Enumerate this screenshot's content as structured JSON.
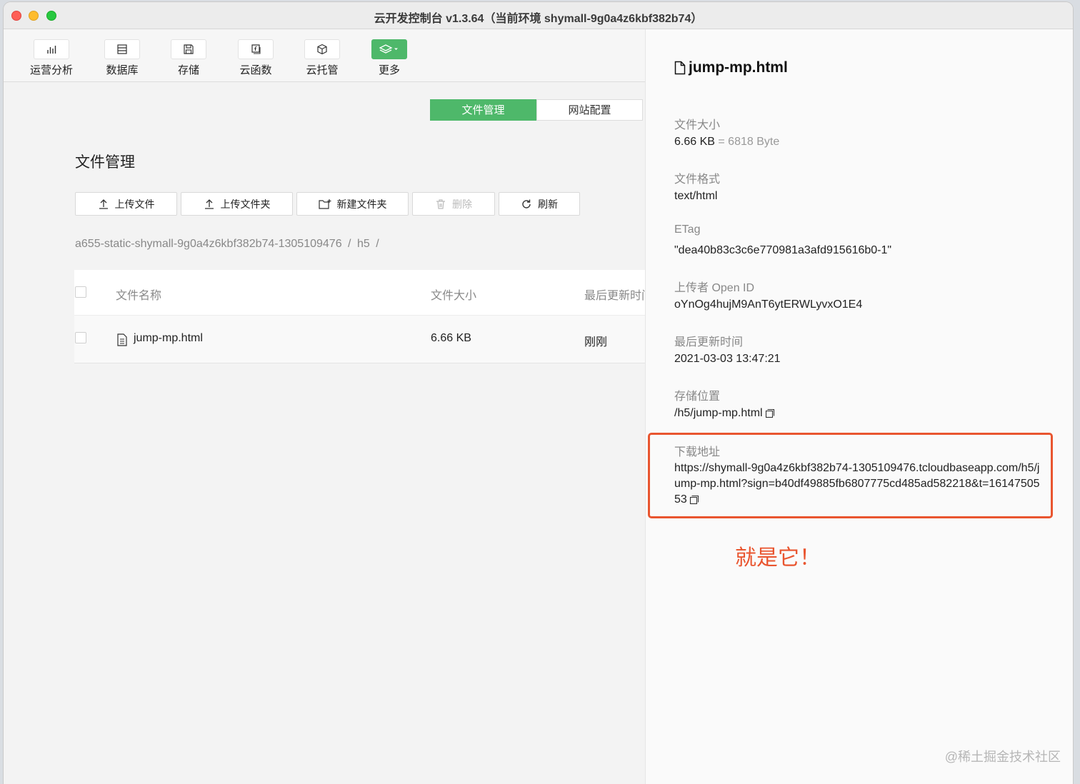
{
  "window": {
    "title": "云开发控制台 v1.3.64（当前环境 shymall-9g0a4z6kbf382b74）"
  },
  "toolbar": {
    "items": [
      {
        "label": "运营分析",
        "icon": "bar-chart-icon"
      },
      {
        "label": "数据库",
        "icon": "database-icon"
      },
      {
        "label": "存储",
        "icon": "storage-icon"
      },
      {
        "label": "云函数",
        "icon": "function-icon"
      },
      {
        "label": "云托管",
        "icon": "cube-icon"
      },
      {
        "label": "更多",
        "icon": "layers-icon"
      }
    ]
  },
  "tabs": {
    "file_manage": "文件管理",
    "site_config": "网站配置"
  },
  "section": {
    "title": "文件管理"
  },
  "actions": {
    "upload_file": "上传文件",
    "upload_folder": "上传文件夹",
    "new_folder": "新建文件夹",
    "delete": "删除",
    "refresh": "刷新"
  },
  "breadcrumb": {
    "path": "a655-static-shymall-9g0a4z6kbf382b74-1305109476",
    "sep1": "/",
    "folder": "h5",
    "sep2": "/"
  },
  "table": {
    "headers": {
      "name": "文件名称",
      "size": "文件大小",
      "updated": "最后更新时间"
    },
    "rows": [
      {
        "name": "jump-mp.html",
        "size": "6.66 KB",
        "updated": "刚刚"
      }
    ]
  },
  "detail": {
    "filename": "jump-mp.html",
    "size_label": "文件大小",
    "size_value": "6.66 KB",
    "size_bytes": "= 6818 Byte",
    "format_label": "文件格式",
    "format_value": "text/html",
    "etag_label": "ETag",
    "etag_value": "\"dea40b83c3c6e770981a3afd915616b0-1\"",
    "uploader_label": "上传者 Open ID",
    "uploader_value": "oYnOg4hujM9AnT6ytERWLyvxO1E4",
    "updated_label": "最后更新时间",
    "updated_value": "2021-03-03 13:47:21",
    "location_label": "存储位置",
    "location_value": "/h5/jump-mp.html",
    "download_label": "下载地址",
    "download_url": "https://shymall-9g0a4z6kbf382b74-1305109476.tcloudbaseapp.com/h5/jump-mp.html?sign=b40df49885fb6807775cd485ad582218&t=1614750553"
  },
  "annotation": {
    "text": "就是它！"
  },
  "watermark": {
    "text": "@稀土掘金技术社区"
  },
  "colors": {
    "accent": "#4eb86a",
    "highlight": "#e9552f"
  }
}
